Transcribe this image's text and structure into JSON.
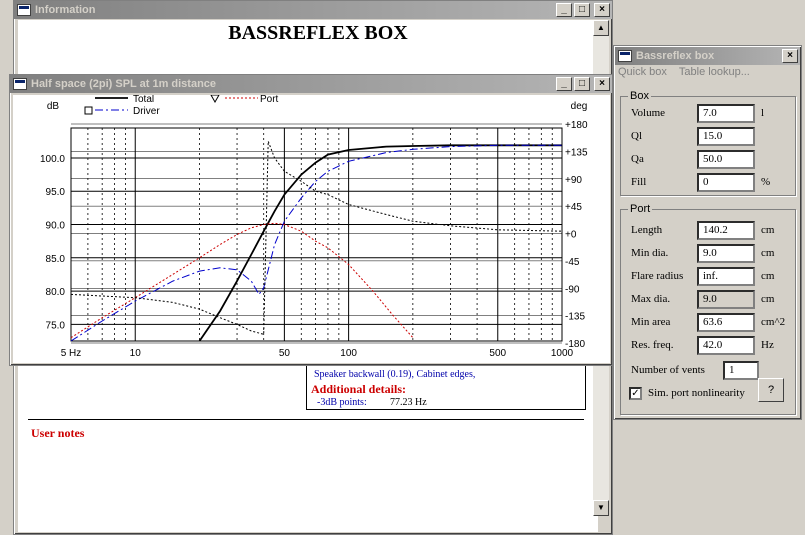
{
  "info_window": {
    "title": "Information",
    "heading": "BASSREFLEX BOX",
    "partial_line": "Speaker backwall (0.19), Cabinet edges,",
    "details_heading": "Additional details:",
    "details_label": "-3dB points:",
    "details_value": "77.23 Hz",
    "user_notes": "User notes"
  },
  "graph_window": {
    "title": "Half space (2pi) SPL at 1m distance"
  },
  "window_buttons": {
    "minimize": "_",
    "maximize": "□",
    "close": "×"
  },
  "chart_data": {
    "type": "line",
    "xscale": "log",
    "x_ticks": [
      "5 Hz",
      "10",
      "50",
      "100",
      "500",
      "1000"
    ],
    "y_unit_left": "dB",
    "y_unit_right": "deg",
    "y_ticks_left": [
      "100.0",
      "95.0",
      "90.0",
      "85.0",
      "80.0",
      "75.0"
    ],
    "y_ticks_right": [
      "+180",
      "+135",
      "+90",
      "+45",
      "+0",
      "-45",
      "-90",
      "-135",
      "-180"
    ],
    "xlim": [
      5,
      1000
    ],
    "ylim": [
      72.5,
      104.5
    ],
    "legend": [
      "Total",
      "Driver",
      "Port"
    ],
    "series": [
      {
        "name": "Total",
        "style": "solid",
        "color": "#000000",
        "x": [
          20,
          25,
          30,
          35,
          40,
          45,
          50,
          60,
          70,
          80,
          100,
          150,
          200,
          300,
          500,
          1000
        ],
        "y": [
          72.5,
          77,
          81.5,
          85.5,
          89,
          92,
          94.5,
          97.5,
          99.3,
          100.5,
          101.2,
          101.7,
          101.8,
          101.9,
          101.9,
          101.9
        ]
      },
      {
        "name": "Driver",
        "style": "dashdot",
        "color": "#0000cc",
        "x": [
          5,
          7,
          10,
          15,
          20,
          25,
          30,
          35,
          38,
          40,
          45,
          50,
          60,
          70,
          80,
          100,
          150,
          200,
          300,
          500,
          1000
        ],
        "y": [
          72.5,
          75.5,
          78.5,
          81.5,
          83,
          83.5,
          83.2,
          81.5,
          79.5,
          80.5,
          87,
          90.5,
          94,
          96.5,
          98,
          99.5,
          100.8,
          101.3,
          101.7,
          101.9,
          101.9
        ]
      },
      {
        "name": "Port",
        "style": "dotted",
        "color": "#cc0000",
        "x": [
          5,
          7,
          10,
          15,
          20,
          25,
          30,
          35,
          40,
          45,
          50,
          60,
          70,
          80,
          100,
          130,
          160,
          200
        ],
        "y": [
          73,
          76,
          79,
          82.5,
          85,
          87,
          88.5,
          89.5,
          90,
          90.2,
          90,
          89,
          87.5,
          86.5,
          84,
          80,
          76.5,
          73
        ]
      },
      {
        "name": "Phase",
        "style": "dotted",
        "color": "#000000",
        "x": [
          5,
          10,
          15,
          20,
          25,
          30,
          35,
          40,
          42,
          45,
          50,
          60,
          70,
          80,
          100,
          150,
          200,
          300,
          500,
          1000
        ],
        "y": [
          79.5,
          79,
          78.3,
          77.3,
          76,
          75,
          74,
          73.5,
          102.5,
          100,
          98,
          96.5,
          95,
          94.5,
          93,
          91.5,
          90.5,
          89.8,
          89.2,
          89
        ]
      }
    ]
  },
  "br_window": {
    "title": "Bassreflex box",
    "menu": [
      "Quick box",
      "Table lookup..."
    ],
    "box_group": "Box",
    "box_fields": [
      {
        "label": "Volume",
        "value": "7.0",
        "unit": "l"
      },
      {
        "label": "Ql",
        "value": "15.0",
        "unit": ""
      },
      {
        "label": "Qa",
        "value": "50.0",
        "unit": ""
      },
      {
        "label": "Fill",
        "value": "0",
        "unit": "%"
      }
    ],
    "port_group": "Port",
    "port_fields": [
      {
        "label": "Length",
        "value": "140.2",
        "unit": "cm"
      },
      {
        "label": "Min dia.",
        "value": "9.0",
        "unit": "cm"
      },
      {
        "label": "Flare radius",
        "value": "inf.",
        "unit": "cm"
      },
      {
        "label": "Max dia.",
        "value": "9.0",
        "unit": "cm"
      },
      {
        "label": "Min area",
        "value": "63.6",
        "unit": "cm^2"
      },
      {
        "label": "Res. freq.",
        "value": "42.0",
        "unit": "Hz"
      }
    ],
    "vents_label": "Number of vents",
    "vents_value": "1",
    "nonlinearity_label": "Sim. port nonlinearity",
    "nonlinearity_checked": "✓",
    "help_button": "?"
  }
}
